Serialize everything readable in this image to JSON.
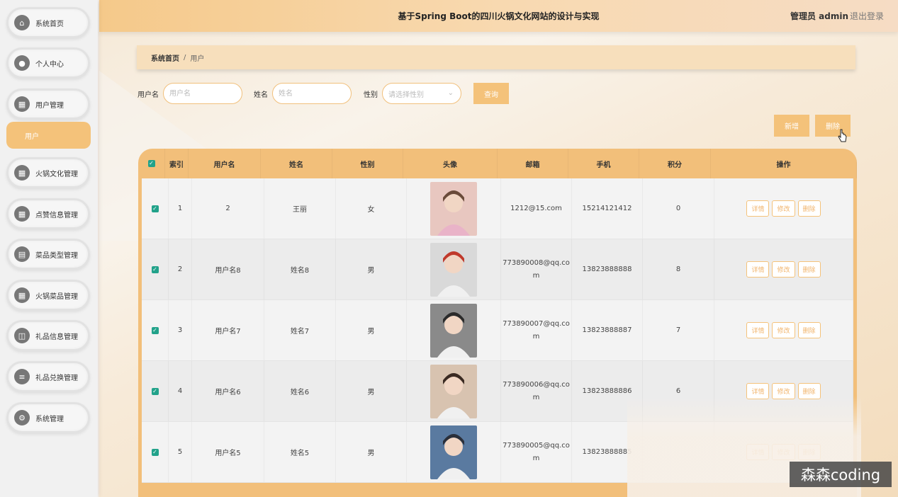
{
  "header": {
    "title": "基于Spring Boot的四川火锅文化网站的设计与实现",
    "user": "管理员 admin",
    "logout": "退出登录"
  },
  "sidebar": {
    "items": [
      {
        "label": "系统首页",
        "icon": "home-icon"
      },
      {
        "label": "个人中心",
        "icon": "user-icon"
      },
      {
        "label": "用户管理",
        "icon": "grid-icon"
      },
      {
        "label": "火锅文化管理",
        "icon": "grid-icon"
      },
      {
        "label": "点赞信息管理",
        "icon": "grid-icon"
      },
      {
        "label": "菜品类型管理",
        "icon": "doc-icon"
      },
      {
        "label": "火锅菜品管理",
        "icon": "grid-icon"
      },
      {
        "label": "礼品信息管理",
        "icon": "gift-icon"
      },
      {
        "label": "礼品兑换管理",
        "icon": "list-icon"
      },
      {
        "label": "系统管理",
        "icon": "settings-icon"
      }
    ],
    "sub_item": "用户"
  },
  "breadcrumb": {
    "home": "系统首页",
    "sep": "/",
    "current": "用户"
  },
  "search": {
    "username_label": "用户名",
    "username_placeholder": "用户名",
    "name_label": "姓名",
    "name_placeholder": "姓名",
    "gender_label": "性别",
    "gender_placeholder": "请选择性别",
    "query_button": "查询"
  },
  "actions": {
    "add": "新增",
    "delete": "删除"
  },
  "table": {
    "headers": [
      "索引",
      "用户名",
      "姓名",
      "性别",
      "头像",
      "邮箱",
      "手机",
      "积分",
      "操作"
    ],
    "ops": [
      "详情",
      "修改",
      "删除"
    ],
    "rows": [
      {
        "index": "1",
        "username": "2",
        "name": "王丽",
        "gender": "女",
        "email": "1212@15.com",
        "email2": "",
        "phone": "15214121412",
        "points": "0"
      },
      {
        "index": "2",
        "username": "用户名8",
        "name": "姓名8",
        "gender": "男",
        "email": "773890008@qq.co",
        "email2": "m",
        "phone": "13823888888",
        "points": "8"
      },
      {
        "index": "3",
        "username": "用户名7",
        "name": "姓名7",
        "gender": "男",
        "email": "773890007@qq.co",
        "email2": "m",
        "phone": "13823888887",
        "points": "7"
      },
      {
        "index": "4",
        "username": "用户名6",
        "name": "姓名6",
        "gender": "男",
        "email": "773890006@qq.co",
        "email2": "m",
        "phone": "13823888886",
        "points": "6"
      },
      {
        "index": "5",
        "username": "用户名5",
        "name": "姓名5",
        "gender": "男",
        "email": "773890005@qq.co",
        "email2": "m",
        "phone": "13823888885",
        "points": ""
      }
    ]
  },
  "watermark": "森森coding",
  "colors": {
    "accent": "#f4c27a",
    "check": "#22a28a"
  }
}
